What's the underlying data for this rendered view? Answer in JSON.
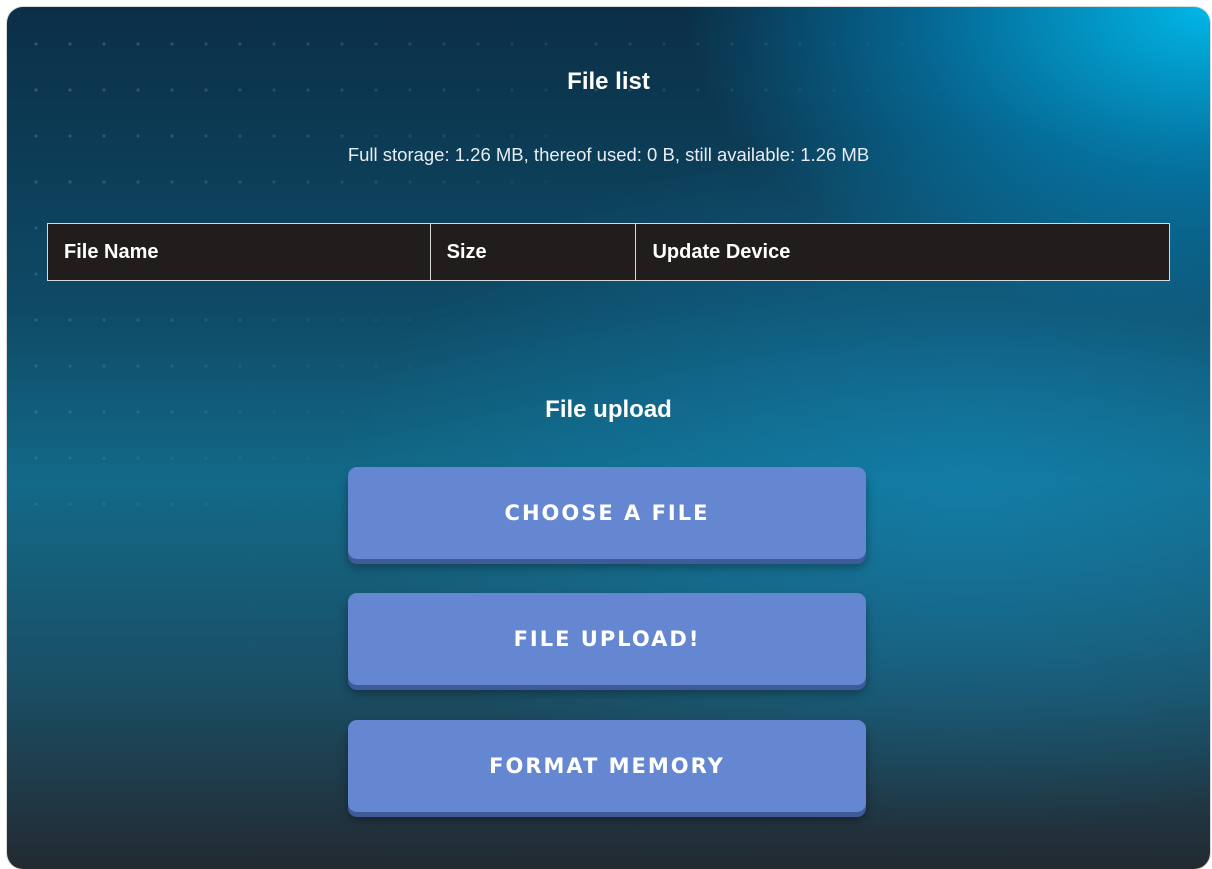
{
  "file_list": {
    "title": "File list",
    "storage_info": "Full storage: 1.26 MB, thereof used: 0 B, still available: 1.26 MB",
    "columns": [
      "File Name",
      "Size",
      "Update Device"
    ],
    "rows": []
  },
  "file_upload": {
    "title": "File upload",
    "choose_label": "CHOOSE A FILE",
    "upload_label": "FILE UPLOAD!",
    "format_label": "FORMAT MEMORY"
  },
  "colors": {
    "button": "#6586d1",
    "table_header_bg": "#211d1c",
    "accent_glow": "#00bef0"
  }
}
